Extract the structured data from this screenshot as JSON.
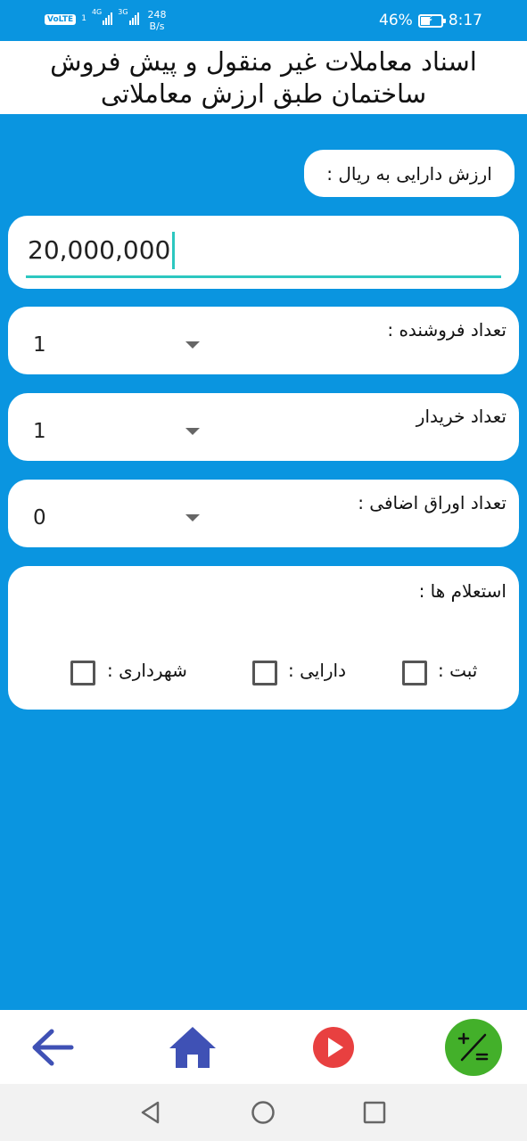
{
  "status_bar": {
    "volte": "VoLTE",
    "sim": "1",
    "signal1_type": "4G",
    "signal2_type": "3G",
    "speed_value": "248",
    "speed_unit": "B/s",
    "battery": "46%",
    "time": "8:17"
  },
  "header": {
    "title_line1": "اسناد معاملات غیر منقول و پیش فروش",
    "title_line2": "ساختمان طبق ارزش معاملاتی"
  },
  "form": {
    "asset_value_label": "ارزش دارایی به ریال :",
    "asset_value": "20,000,000",
    "sellers_label": "تعداد فروشنده :",
    "sellers_value": "1",
    "buyers_label": "تعداد خریدار",
    "buyers_value": "1",
    "extra_pages_label": "تعداد اوراق اضافی :",
    "extra_pages_value": "0"
  },
  "inquiries": {
    "title": "استعلام ها :",
    "registry_label": "ثبت :",
    "registry_checked": false,
    "finance_label": "دارایی :",
    "finance_checked": false,
    "municipality_label": "شهرداری :",
    "municipality_checked": false
  },
  "bottom_nav": {
    "back_icon": "arrow-left-icon",
    "home_icon": "home-icon",
    "play_icon": "play-icon",
    "calc_icon": "plus-minus-icon",
    "back_color": "#3f51b5",
    "home_color": "#3f51b5",
    "play_color": "#e84040",
    "calc_color": "#43b02a"
  },
  "colors": {
    "background": "#0a95e0",
    "input_accent": "#2cc7c0"
  }
}
